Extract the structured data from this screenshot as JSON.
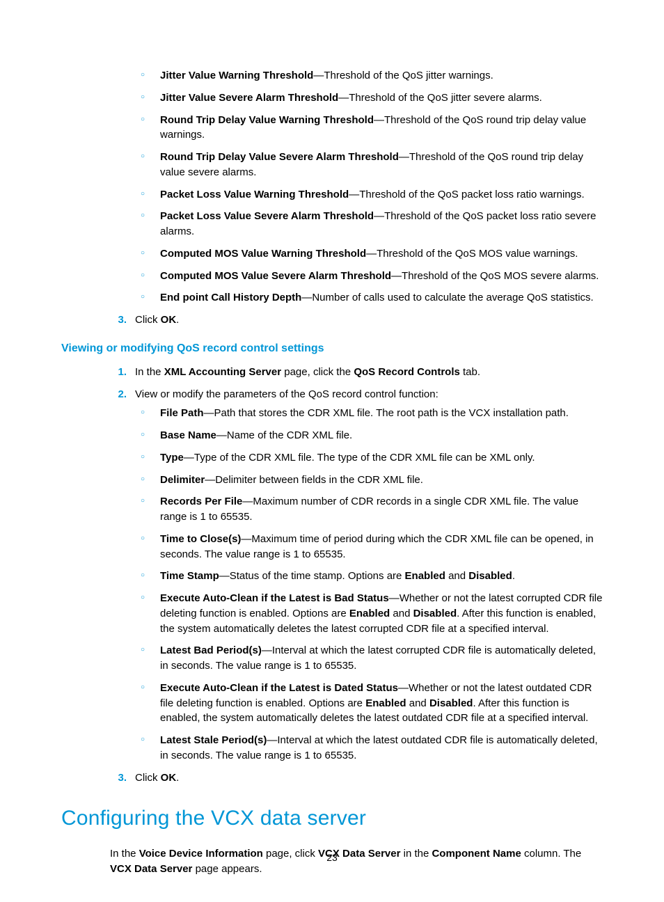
{
  "listA": {
    "items": [
      {
        "term": "Jitter Value Warning Threshold",
        "desc": "—Threshold of the QoS jitter warnings."
      },
      {
        "term": "Jitter Value Severe Alarm Threshold",
        "desc": "—Threshold of the QoS jitter severe alarms."
      },
      {
        "term": "Round Trip Delay Value Warning Threshold",
        "desc": "—Threshold of the QoS round trip delay value warnings."
      },
      {
        "term": "Round Trip Delay Value Severe Alarm Threshold",
        "desc": "—Threshold of the QoS round trip delay value severe alarms."
      },
      {
        "term": "Packet Loss Value Warning Threshold",
        "desc": "—Threshold of the QoS packet loss ratio warnings."
      },
      {
        "term": "Packet Loss Value Severe Alarm Threshold",
        "desc": "—Threshold of the QoS packet loss ratio severe alarms."
      },
      {
        "term": "Computed MOS Value Warning Threshold",
        "desc": "—Threshold of the QoS MOS value warnings."
      },
      {
        "term": "Computed MOS Value Severe Alarm Threshold",
        "desc": "—Threshold of the QoS MOS severe alarms."
      },
      {
        "term": "End point Call History Depth",
        "desc": "—Number of calls used to calculate the average QoS statistics."
      }
    ],
    "step3_num": "3.",
    "step3_pre": "Click ",
    "step3_bold": "OK",
    "step3_post": "."
  },
  "subheading": "Viewing or modifying QoS record control settings",
  "listB": {
    "step1_num": "1.",
    "step1_pre": "In the ",
    "step1_b1": "XML Accounting Server",
    "step1_mid": " page, click the ",
    "step1_b2": "QoS Record Controls",
    "step1_post": " tab.",
    "step2_num": "2.",
    "step2_text": "View or modify the parameters of the QoS record control function:",
    "items": [
      {
        "term": "File Path",
        "desc": "—Path that stores the CDR XML file. The root path is the VCX installation path."
      },
      {
        "term": "Base Name",
        "desc": "—Name of the CDR XML file."
      },
      {
        "term": "Type",
        "desc": "—Type of the CDR XML file. The type of the CDR XML file can be XML only."
      },
      {
        "term": "Delimiter",
        "desc": "—Delimiter between fields in the CDR XML file."
      },
      {
        "term": "Records Per File",
        "desc": "—Maximum number of CDR records in a single CDR XML file. The value range is 1 to 65535."
      },
      {
        "term": "Time to Close(s)",
        "desc": "—Maximum time of period during which the CDR XML file can be opened, in seconds. The value range is 1 to 65535."
      }
    ],
    "ts_term": "Time Stamp",
    "ts_pre": "—Status of the time stamp. Options are ",
    "ts_b1": "Enabled",
    "ts_and": " and ",
    "ts_b2": "Disabled",
    "ts_post": ".",
    "acbad_term": "Execute Auto-Clean if the Latest is Bad Status",
    "acbad_pre": "—Whether or not the latest corrupted CDR file deleting function is enabled. Options are ",
    "acbad_b1": "Enabled",
    "acbad_and": " and ",
    "acbad_b2": "Disabled",
    "acbad_post": ". After this function is enabled, the system automatically deletes the latest corrupted CDR file at a specified interval.",
    "lbp_term": "Latest Bad Period(s)",
    "lbp_desc": "—Interval at which the latest corrupted CDR file is automatically deleted, in seconds. The value range is 1 to 65535.",
    "acdated_term": "Execute Auto-Clean if the Latest is Dated Status",
    "acdated_pre": "—Whether or not the latest outdated CDR file deleting function is enabled. Options are ",
    "acdated_b1": "Enabled",
    "acdated_and": " and ",
    "acdated_b2": "Disabled",
    "acdated_post": ". After this function is enabled, the system automatically deletes the latest outdated CDR file at a specified interval.",
    "lsp_term": "Latest Stale Period(s)",
    "lsp_desc": "—Interval at which the latest outdated CDR file is automatically deleted, in seconds. The value range is 1 to 65535.",
    "step3_num": "3.",
    "step3_pre": "Click ",
    "step3_bold": "OK",
    "step3_post": "."
  },
  "heading": "Configuring the VCX data server",
  "intro": {
    "pre": "In the ",
    "b1": "Voice Device Information",
    "mid1": " page, click ",
    "b2": "VCX Data Server",
    "mid2": " in the ",
    "b3": "Component Name",
    "mid3": " column. The ",
    "b4": "VCX Data Server",
    "post": " page appears."
  },
  "pagenum": "23"
}
